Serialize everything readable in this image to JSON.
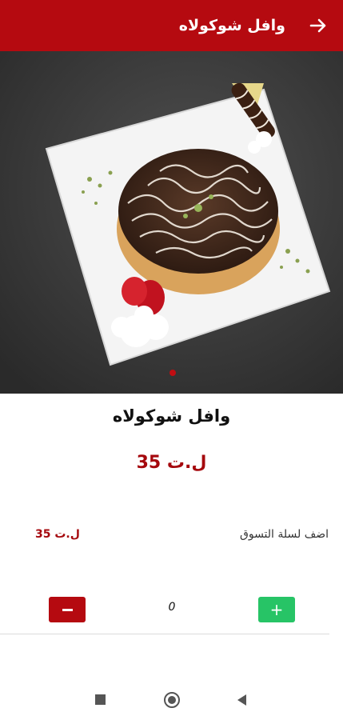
{
  "header": {
    "title": "وافل شوكولاه",
    "back_icon": "arrow-right-icon",
    "color": "#b50a10"
  },
  "product": {
    "name": "وافل شوكولاه",
    "price": "35 ل.ت",
    "image_icon": "chocolate-waffle-photo",
    "carousel_pages": 1,
    "carousel_active": 1
  },
  "cart": {
    "label": "اضف لسلة التسوق",
    "price": "35 ل.ت"
  },
  "quantity": {
    "value": "0",
    "minus_color": "#b50a10",
    "plus_color": "#27c466",
    "plus_label": "+"
  },
  "system_nav": {
    "recents_icon": "square-icon",
    "home_icon": "circle-icon",
    "back_icon": "triangle-back-icon"
  }
}
